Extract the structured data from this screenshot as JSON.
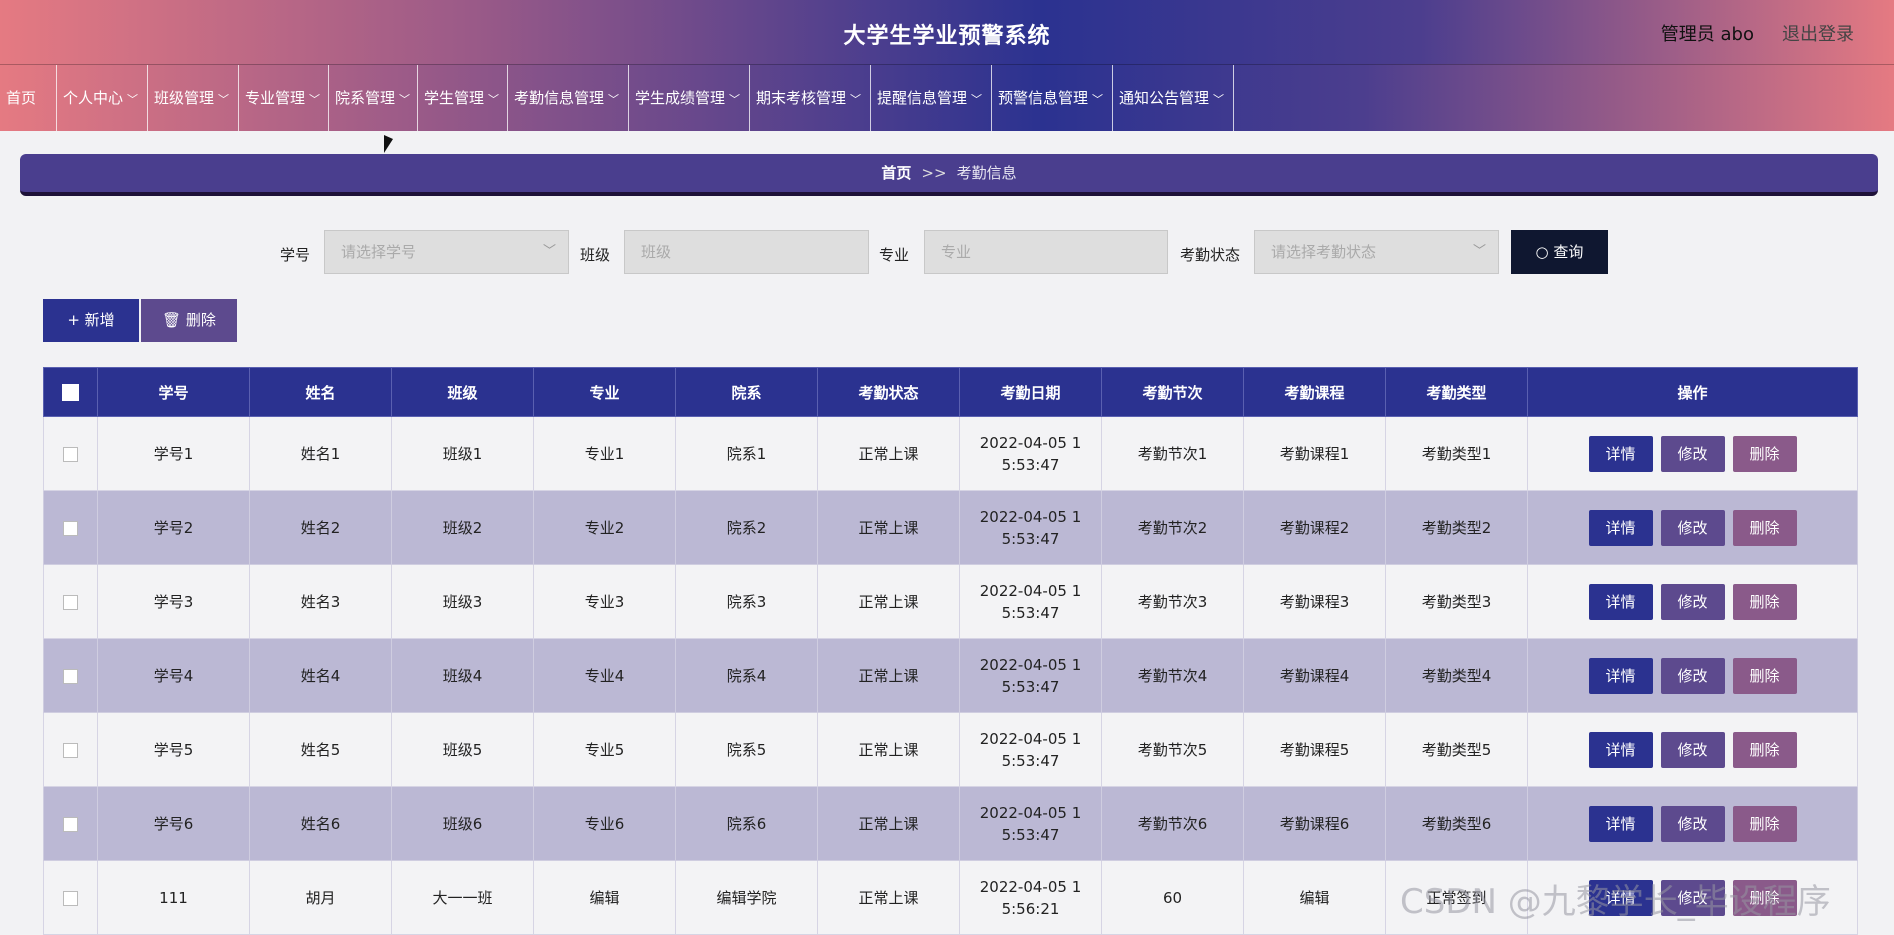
{
  "header": {
    "title": "大学生学业预警系统",
    "user": "管理员 abo",
    "logout": "退出登录"
  },
  "nav": [
    {
      "label": "首页"
    },
    {
      "label": "个人中心",
      "chevron": "﹀"
    },
    {
      "label": "班级管理",
      "chevron": "﹀"
    },
    {
      "label": "专业管理",
      "chevron": "﹀"
    },
    {
      "label": "院系管理",
      "chevron": "﹀"
    },
    {
      "label": "学生管理",
      "chevron": "﹀"
    },
    {
      "label": "考勤信息管理",
      "chevron": "﹀"
    },
    {
      "label": "学生成绩管理",
      "chevron": "﹀"
    },
    {
      "label": "期末考核管理",
      "chevron": "﹀"
    },
    {
      "label": "提醒信息管理",
      "chevron": "﹀"
    },
    {
      "label": "预警信息管理",
      "chevron": "﹀"
    },
    {
      "label": "通知公告管理",
      "chevron": "﹀"
    }
  ],
  "breadcrumb": {
    "home": "首页",
    "sep": ">>",
    "current": "考勤信息"
  },
  "search": {
    "student_no_label": "学号",
    "student_no_placeholder": "请选择学号",
    "class_label": "班级",
    "class_placeholder": "班级",
    "major_label": "专业",
    "major_placeholder": "专业",
    "status_label": "考勤状态",
    "status_placeholder": "请选择考勤状态",
    "query_button": "查询",
    "arrow": "﹀"
  },
  "actions": {
    "add": "新增",
    "delete": "删除"
  },
  "table": {
    "columns": [
      "学号",
      "姓名",
      "班级",
      "专业",
      "院系",
      "考勤状态",
      "考勤日期",
      "考勤节次",
      "考勤课程",
      "考勤类型",
      "操作"
    ],
    "row_buttons": {
      "detail": "详情",
      "edit": "修改",
      "delete": "删除"
    },
    "rows": [
      {
        "student_no": "学号1",
        "name": "姓名1",
        "class": "班级1",
        "major": "专业1",
        "department": "院系1",
        "status": "正常上课",
        "date": "2022-04-05 15:53:47",
        "period": "考勤节次1",
        "course": "考勤课程1",
        "type": "考勤类型1"
      },
      {
        "student_no": "学号2",
        "name": "姓名2",
        "class": "班级2",
        "major": "专业2",
        "department": "院系2",
        "status": "正常上课",
        "date": "2022-04-05 15:53:47",
        "period": "考勤节次2",
        "course": "考勤课程2",
        "type": "考勤类型2"
      },
      {
        "student_no": "学号3",
        "name": "姓名3",
        "class": "班级3",
        "major": "专业3",
        "department": "院系3",
        "status": "正常上课",
        "date": "2022-04-05 15:53:47",
        "period": "考勤节次3",
        "course": "考勤课程3",
        "type": "考勤类型3"
      },
      {
        "student_no": "学号4",
        "name": "姓名4",
        "class": "班级4",
        "major": "专业4",
        "department": "院系4",
        "status": "正常上课",
        "date": "2022-04-05 15:53:47",
        "period": "考勤节次4",
        "course": "考勤课程4",
        "type": "考勤类型4"
      },
      {
        "student_no": "学号5",
        "name": "姓名5",
        "class": "班级5",
        "major": "专业5",
        "department": "院系5",
        "status": "正常上课",
        "date": "2022-04-05 15:53:47",
        "period": "考勤节次5",
        "course": "考勤课程5",
        "type": "考勤类型5"
      },
      {
        "student_no": "学号6",
        "name": "姓名6",
        "class": "班级6",
        "major": "专业6",
        "department": "院系6",
        "status": "正常上课",
        "date": "2022-04-05 15:53:47",
        "period": "考勤节次6",
        "course": "考勤课程6",
        "type": "考勤类型6"
      },
      {
        "student_no": "111",
        "name": "胡月",
        "class": "大一一班",
        "major": "编辑",
        "department": "编辑学院",
        "status": "正常上课",
        "date": "2022-04-05 15:56:21",
        "period": "60",
        "course": "编辑",
        "type": "正常签到"
      }
    ]
  },
  "watermark": "CSDN @九黎学长_毕设程序",
  "colors": {
    "primary": "#2b3290",
    "secondary": "#5d4a8e",
    "danger": "#8a5a8a",
    "stripe": "#bbb8d4"
  },
  "icons": {
    "add": "+",
    "trash": "🗑",
    "search": "○"
  }
}
